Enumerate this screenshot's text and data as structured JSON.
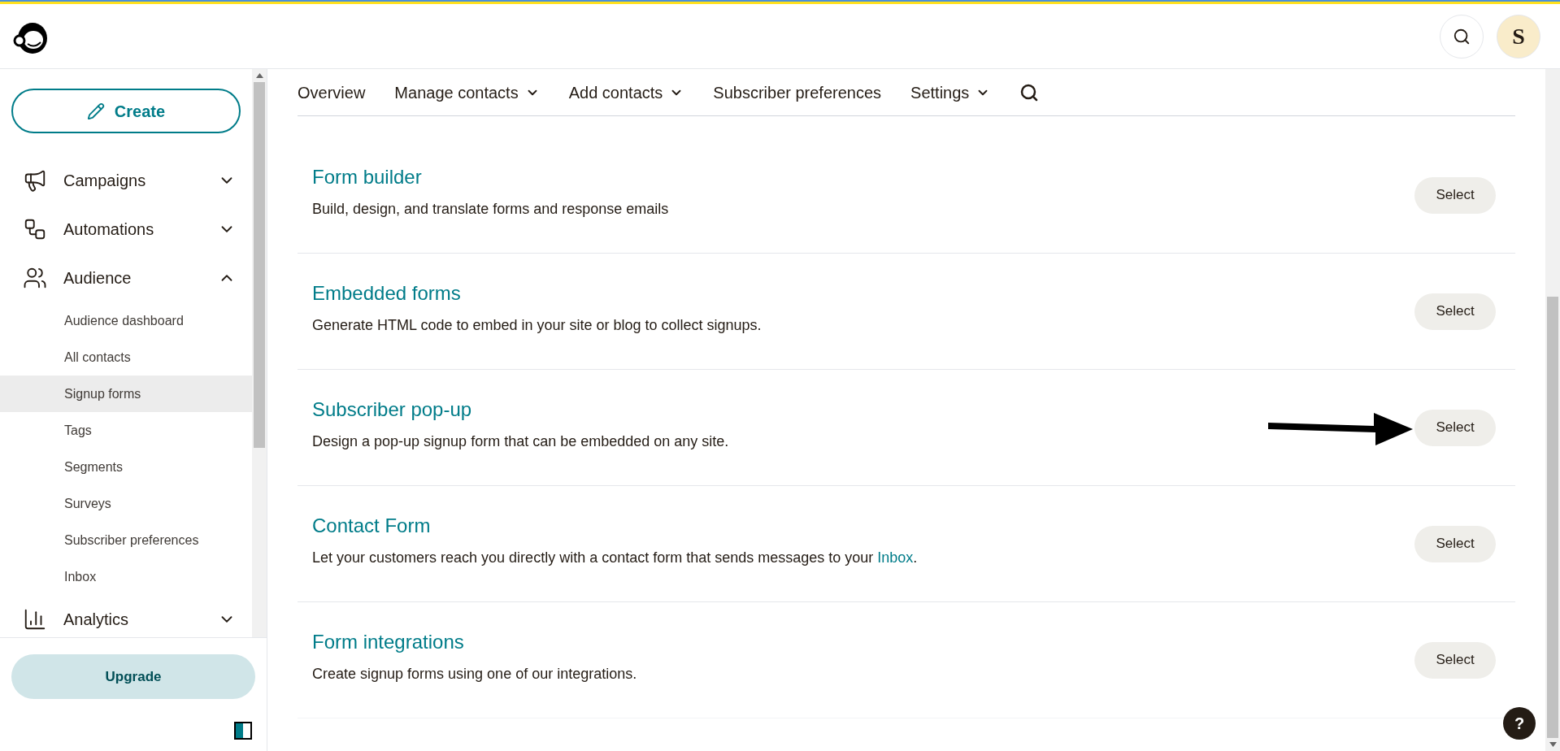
{
  "header": {
    "avatar_letter": "S"
  },
  "sidebar": {
    "create_label": "Create",
    "items": [
      {
        "label": "Campaigns",
        "expanded": false
      },
      {
        "label": "Automations",
        "expanded": false
      },
      {
        "label": "Audience",
        "expanded": true,
        "children": [
          {
            "label": "Audience dashboard",
            "selected": false
          },
          {
            "label": "All contacts",
            "selected": false
          },
          {
            "label": "Signup forms",
            "selected": true
          },
          {
            "label": "Tags",
            "selected": false
          },
          {
            "label": "Segments",
            "selected": false
          },
          {
            "label": "Surveys",
            "selected": false
          },
          {
            "label": "Subscriber preferences",
            "selected": false
          },
          {
            "label": "Inbox",
            "selected": false
          }
        ]
      },
      {
        "label": "Analytics",
        "expanded": false
      }
    ],
    "upgrade_label": "Upgrade"
  },
  "nav": [
    {
      "label": "Overview",
      "dropdown": false
    },
    {
      "label": "Manage contacts",
      "dropdown": true
    },
    {
      "label": "Add contacts",
      "dropdown": true
    },
    {
      "label": "Subscriber preferences",
      "dropdown": false
    },
    {
      "label": "Settings",
      "dropdown": true
    }
  ],
  "forms": [
    {
      "title": "Form builder",
      "description": "Build, design, and translate forms and response emails",
      "button": "Select",
      "arrow": false
    },
    {
      "title": "Embedded forms",
      "description": "Generate HTML code to embed in your site or blog to collect signups.",
      "button": "Select",
      "arrow": false
    },
    {
      "title": "Subscriber pop-up",
      "description": "Design a pop-up signup form that can be embedded on any site.",
      "button": "Select",
      "arrow": true
    },
    {
      "title": "Contact Form",
      "description": "Let your customers reach you directly with a contact form that sends messages to your ",
      "link": "Inbox",
      "suffix": ".",
      "button": "Select",
      "arrow": false
    },
    {
      "title": "Form integrations",
      "description": "Create signup forms using one of our integrations.",
      "button": "Select",
      "arrow": false
    }
  ],
  "help_label": "?"
}
